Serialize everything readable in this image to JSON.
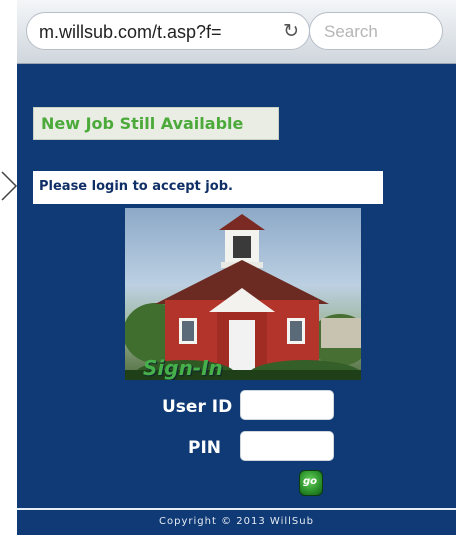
{
  "browser": {
    "url": "m.willsub.com/t.asp?f=",
    "search_placeholder": "Search"
  },
  "notice": {
    "banner": "New Job Still Available",
    "login_message": "Please login to accept job."
  },
  "login": {
    "image_caption": "Sign-In",
    "user_id_label": "User ID",
    "pin_label": "PIN",
    "go_label": "go"
  },
  "footer": {
    "copyright": "Copyright © 2013 WillSub"
  },
  "colors": {
    "background": "#0f3a75",
    "banner_text": "#4caa3a",
    "go_button": "#2a8f2a"
  }
}
